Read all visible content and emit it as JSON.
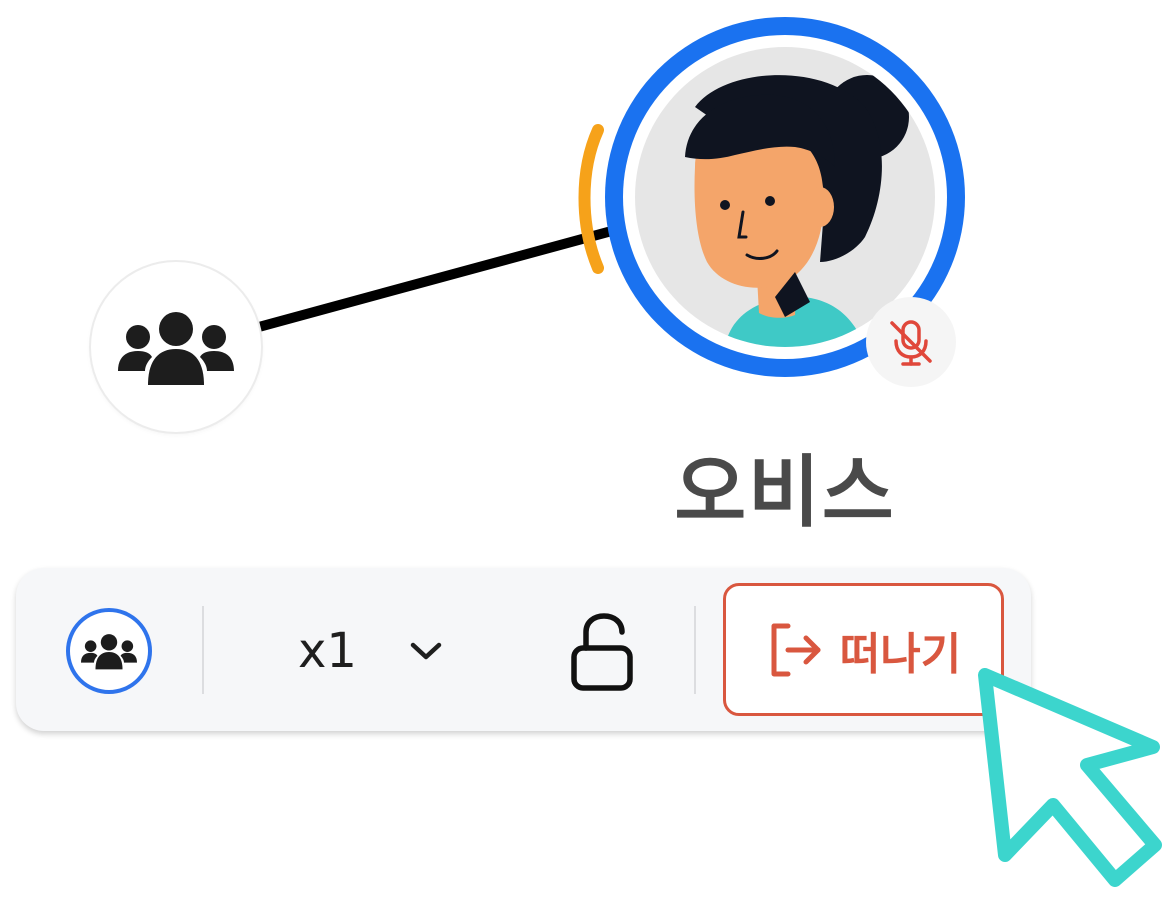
{
  "participant": {
    "name": "오비스",
    "muted": true,
    "speaking": true
  },
  "toolbar": {
    "zoom_value": "x1",
    "leave_label": "떠나기"
  },
  "icons": {
    "group_node": "people-group-icon",
    "mute": "mic-off-icon",
    "toolbar_group": "people-group-icon",
    "zoom_dropdown": "chevron-down-icon",
    "lock": "lock-open-icon",
    "leave": "exit-icon",
    "cursor": "pointer-cursor-icon"
  },
  "colors": {
    "avatar_ring": "#1a72f0",
    "speaking_indicator": "#f6a21a",
    "leave_accent": "#d9573f",
    "cursor": "#3cd5cd",
    "name_text": "#4a4a4a"
  }
}
